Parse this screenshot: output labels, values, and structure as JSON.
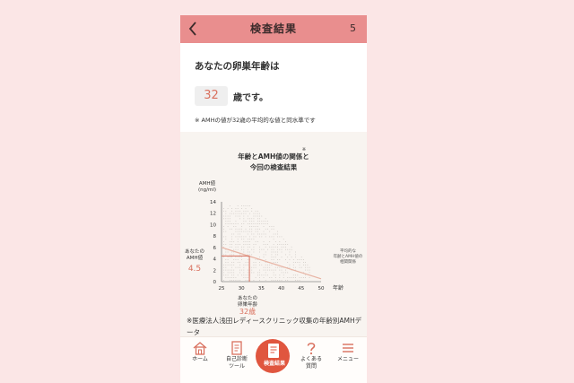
{
  "header": {
    "title": "検査結果",
    "page_number": "5"
  },
  "result": {
    "question": "あなたの卵巣年齢は",
    "age": "32",
    "age_suffix": "歳です。",
    "note": "※ AMHの値が32歳の平均的な値と同水準です"
  },
  "chart": {
    "title_line1": "年齢とAMH値の関係と",
    "title_mark": "※",
    "title_line2": "今回の検査結果",
    "ylabel_line1": "AMH値",
    "ylabel_line2": "(ng/ml)",
    "xlabel": "年齢",
    "user_value_label_line1": "あなたの",
    "user_value_label_line2": "AMH値",
    "user_value": "4.5",
    "user_age_label_line1": "あなたの",
    "user_age_label_line2": "卵巣年齢",
    "user_age": "32歳",
    "trend_label_line1": "平均的な",
    "trend_label_line2": "年齢とAMH値の",
    "trend_label_line3": "相関関係",
    "colors": {
      "trend": "#e8b4a4",
      "user_marker": "#d9705e",
      "dots": "#c8c2bd"
    }
  },
  "chart_data": {
    "type": "scatter",
    "xlabel": "年齢",
    "ylabel": "AMH値 (ng/ml)",
    "xlim": [
      25,
      50
    ],
    "ylim": [
      0,
      14
    ],
    "x_ticks": [
      25,
      30,
      35,
      40,
      45,
      50
    ],
    "y_ticks": [
      0,
      2,
      4,
      6,
      8,
      10,
      12,
      14
    ],
    "series": [
      {
        "name": "平均的な年齢とAMH値の相関関係",
        "kind": "trend_line",
        "points": [
          [
            25,
            6.0
          ],
          [
            50,
            0.5
          ]
        ]
      }
    ],
    "highlight": {
      "age": 32,
      "amh": 4.5
    }
  },
  "source_note": "※医療法人浅田レディースクリニック収集の年齢別AMHデータ",
  "tabs": [
    {
      "label": "ホーム",
      "icon": "home-icon"
    },
    {
      "label": "自己診断\nツール",
      "icon": "checklist-icon"
    },
    {
      "label": "検査結果",
      "icon": "report-icon",
      "active": true
    },
    {
      "label": "よくある\n質問",
      "icon": "question-icon"
    },
    {
      "label": "メニュー",
      "icon": "menu-icon"
    }
  ]
}
